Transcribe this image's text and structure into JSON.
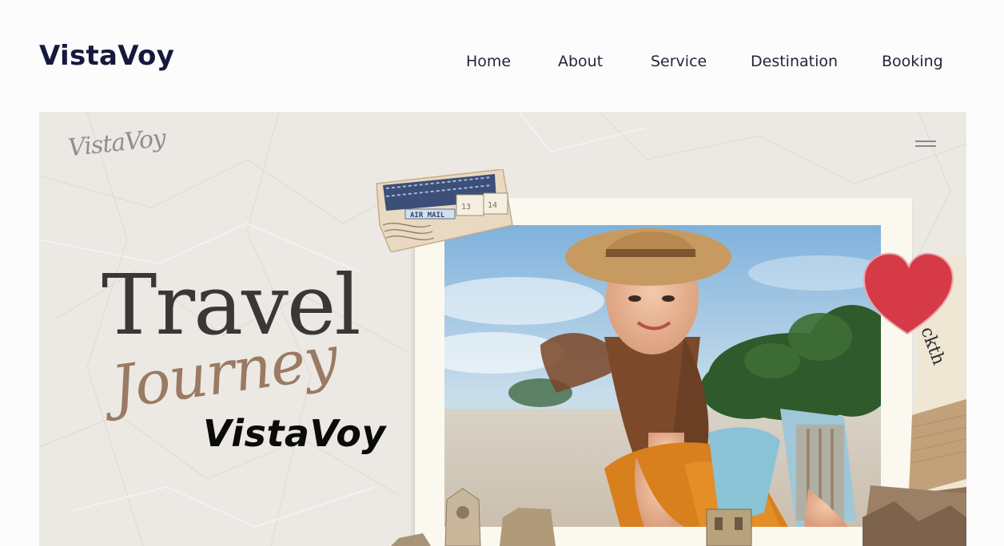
{
  "header": {
    "logo": "VistaVoy",
    "nav": [
      "Home",
      "About",
      "Service",
      "Destination",
      "Booking"
    ]
  },
  "hero": {
    "script_logo": "VistaVoy",
    "headline": "Travel",
    "script_word": "Journey",
    "brand": "VistaVoy",
    "stamp_label": "AIR MAIL",
    "stamp_numbers": [
      "13",
      "14"
    ],
    "collage_text": "ckth",
    "menu_icon": "hamburger-icon"
  },
  "colors": {
    "brand_navy": "#16193d",
    "headline": "#3b3735",
    "script": "#9a7a63",
    "heart": "#d63a47",
    "frame": "#fbf8ef"
  }
}
